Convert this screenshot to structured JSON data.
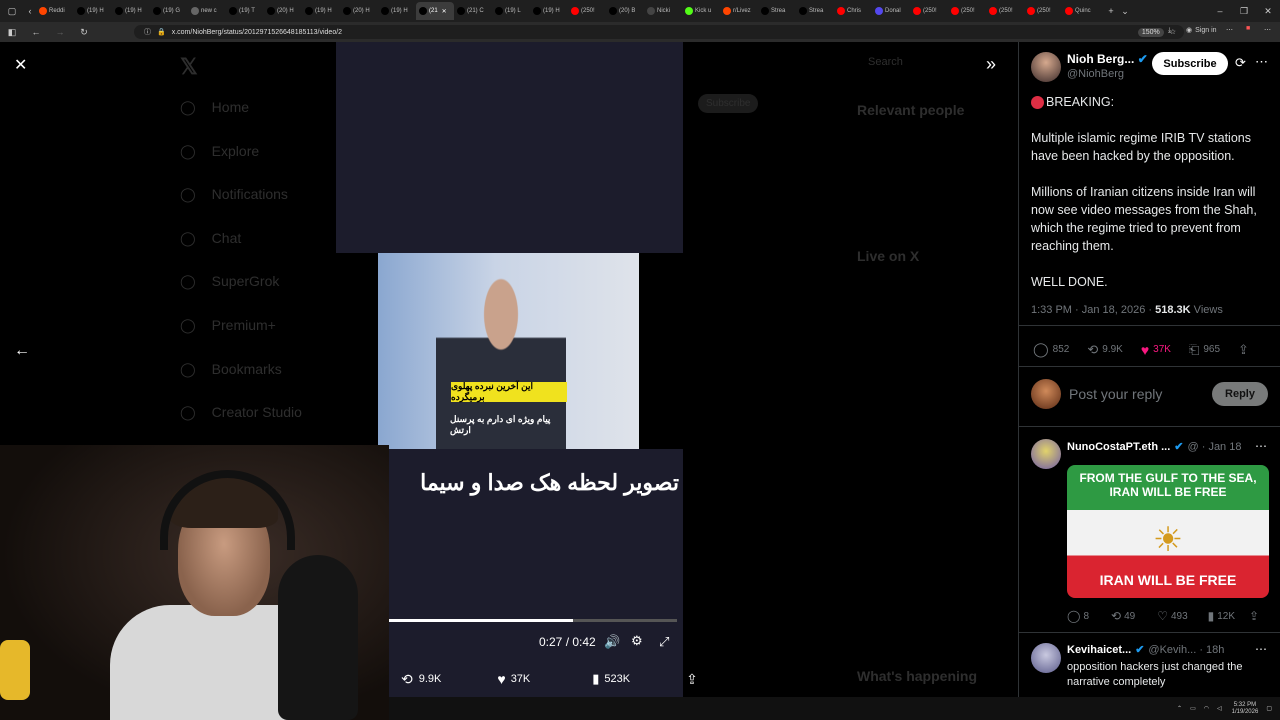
{
  "browser": {
    "tabs": [
      {
        "label": "Reddi",
        "icon": "reddit-icon",
        "color": "#ff4500"
      },
      {
        "label": "(19) H",
        "icon": "x-icon",
        "color": "#000000"
      },
      {
        "label": "(19) H",
        "icon": "x-icon",
        "color": "#000000"
      },
      {
        "label": "(19) G",
        "icon": "x-icon",
        "color": "#000000"
      },
      {
        "label": "new c",
        "icon": "globe-icon",
        "color": "#666666"
      },
      {
        "label": "(19) T",
        "icon": "x-icon",
        "color": "#000000"
      },
      {
        "label": "(20) H",
        "icon": "x-icon",
        "color": "#000000"
      },
      {
        "label": "(19) H",
        "icon": "x-icon",
        "color": "#000000"
      },
      {
        "label": "(20) H",
        "icon": "x-icon",
        "color": "#000000"
      },
      {
        "label": "(19) H",
        "icon": "x-icon",
        "color": "#000000"
      },
      {
        "label": "(21",
        "icon": "x-icon",
        "color": "#000000",
        "active": true
      },
      {
        "label": "(21) C",
        "icon": "x-icon",
        "color": "#000000"
      },
      {
        "label": "(19) L",
        "icon": "x-icon",
        "color": "#000000"
      },
      {
        "label": "(19) H",
        "icon": "x-icon",
        "color": "#000000"
      },
      {
        "label": "(250!",
        "icon": "youtube-icon",
        "color": "#ff0000"
      },
      {
        "label": "(20) B",
        "icon": "x-icon",
        "color": "#000000"
      },
      {
        "label": "Nicki",
        "icon": "blank-icon",
        "color": "#444444"
      },
      {
        "label": "Kick u",
        "icon": "kick-icon",
        "color": "#53fc18"
      },
      {
        "label": "r/Livez",
        "icon": "reddit-icon",
        "color": "#ff4500"
      },
      {
        "label": "Strea",
        "icon": "x-icon",
        "color": "#000000"
      },
      {
        "label": "Strea",
        "icon": "x-icon",
        "color": "#000000"
      },
      {
        "label": "Chris",
        "icon": "youtube-icon",
        "color": "#ff0000"
      },
      {
        "label": "Donal",
        "icon": "truth-icon",
        "color": "#5448ee"
      },
      {
        "label": "(250!",
        "icon": "youtube-icon",
        "color": "#ff0000"
      },
      {
        "label": "(250!",
        "icon": "youtube-icon",
        "color": "#ff0000"
      },
      {
        "label": "(250!",
        "icon": "youtube-icon",
        "color": "#ff0000"
      },
      {
        "label": "(250!",
        "icon": "youtube-icon",
        "color": "#ff0000"
      },
      {
        "label": "Quinc",
        "icon": "youtube-icon",
        "color": "#ff0000"
      }
    ],
    "url": "x.com/NiohBerg/status/2012971526648185113/video/2",
    "zoom": "150%",
    "sign_in": "Sign in"
  },
  "background_page": {
    "nav": [
      "Home",
      "Explore",
      "Notifications",
      "Chat",
      "SuperGrok",
      "Premium+",
      "Bookmarks",
      "Creator Studio"
    ],
    "search": "Search",
    "relevant_people": "Relevant people",
    "live_on_x": "Live on X",
    "whats_happening": "What's happening",
    "subscribe": "Subscribe"
  },
  "video": {
    "subtitle_yellow": "این آخرین نبرده پهلوی برمیگرده",
    "subtitle_white": "پیام ویژه ای دارم به پرسنل ارتش",
    "overlay_caption": "تصویر لحظه هک صدا و سیما",
    "progress": 0.64,
    "time": "0:27 / 0:42",
    "retweets": "9.9K",
    "likes": "37K",
    "views": "523K"
  },
  "tweet": {
    "display_name": "Nioh Berg...",
    "handle": "@NiohBerg",
    "subscribe": "Subscribe",
    "lines": [
      "BREAKING:",
      "Multiple islamic regime IRIB TV stations have been hacked by the opposition.",
      "Millions of Iranian citizens inside Iran will now see video messages from the Shah, which the regime tried to prevent from reaching them.",
      "WELL DONE."
    ],
    "timestamp": "1:33 PM · Jan 18, 2026 · ",
    "views_count": "518.3K",
    "views_label": " Views",
    "stats": {
      "replies": "852",
      "retweets": "9.9K",
      "likes": "37K",
      "bookmarks": "965"
    },
    "reply_placeholder": "Post your reply",
    "reply_button": "Reply"
  },
  "replies": [
    {
      "name": "NunoCostaPT.eth ...",
      "meta": "@ · Jan 18",
      "image_top": "FROM THE GULF TO THE SEA, IRAN WILL BE FREE",
      "image_bottom": "IRAN WILL BE FREE",
      "stats": {
        "replies": "8",
        "retweets": "49",
        "likes": "493",
        "views": "12K"
      }
    },
    {
      "name": "Kevihaicet...",
      "meta": "@Kevih... · 18h",
      "text": "opposition hackers just changed the narrative completely"
    }
  ],
  "taskbar": {
    "time": "5:32 PM",
    "date": "1/19/2026"
  },
  "colors": {
    "like": "#f91880",
    "accent": "#1d9bf0",
    "bg": "#000000",
    "muted": "#71767b"
  }
}
